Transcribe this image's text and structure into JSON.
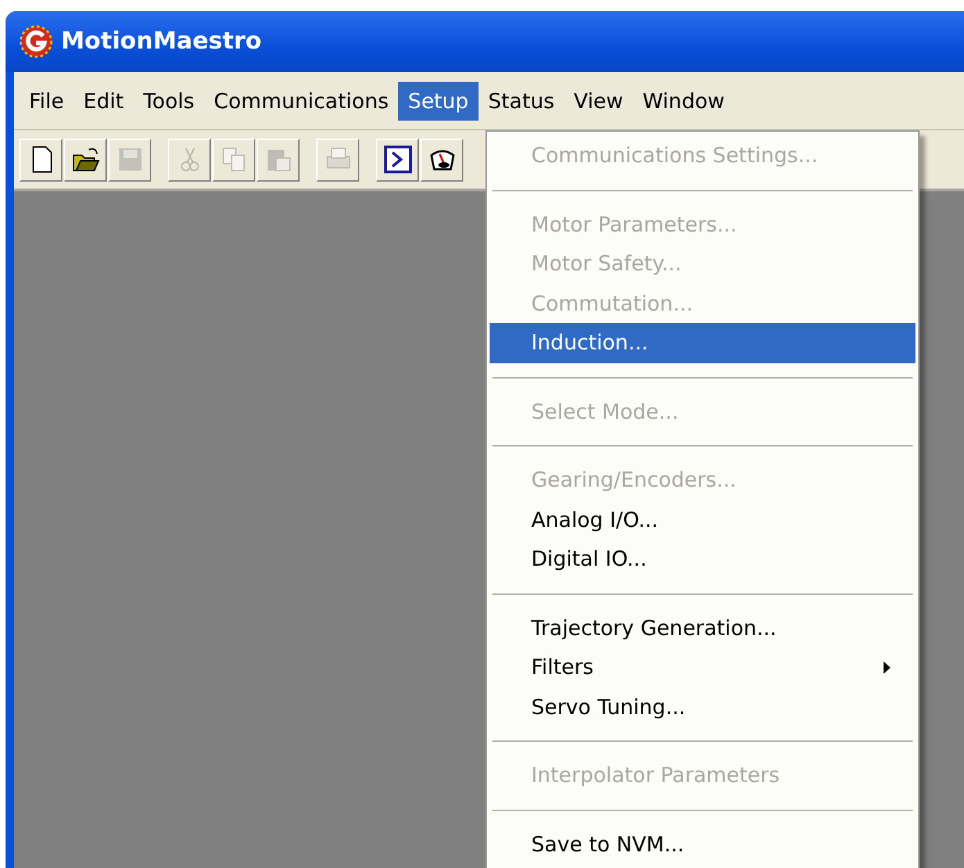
{
  "window": {
    "title": "MotionMaestro"
  },
  "menu_bar": [
    {
      "label": "File",
      "selected": false
    },
    {
      "label": "Edit",
      "selected": false
    },
    {
      "label": "Tools",
      "selected": false
    },
    {
      "label": "Communications",
      "selected": false
    },
    {
      "label": "Setup",
      "selected": true
    },
    {
      "label": "Status",
      "selected": false
    },
    {
      "label": "View",
      "selected": false
    },
    {
      "label": "Window",
      "selected": false
    }
  ],
  "toolbar": [
    {
      "kind": "new",
      "disabled": false
    },
    {
      "kind": "open",
      "disabled": false
    },
    {
      "kind": "save",
      "disabled": true
    },
    {
      "kind": "gap"
    },
    {
      "kind": "cut",
      "disabled": true
    },
    {
      "kind": "copy",
      "disabled": true
    },
    {
      "kind": "paste",
      "disabled": true
    },
    {
      "kind": "gap"
    },
    {
      "kind": "print",
      "disabled": true
    },
    {
      "kind": "gap"
    },
    {
      "kind": "terminal",
      "disabled": false
    },
    {
      "kind": "gauge",
      "disabled": false
    }
  ],
  "dropdown": [
    {
      "kind": "item",
      "label": "Communications Settings...",
      "disabled": true,
      "selected": false
    },
    {
      "kind": "separator"
    },
    {
      "kind": "item",
      "label": "Motor Parameters...",
      "disabled": true,
      "selected": false
    },
    {
      "kind": "item",
      "label": "Motor Safety...",
      "disabled": true,
      "selected": false
    },
    {
      "kind": "item",
      "label": "Commutation...",
      "disabled": true,
      "selected": false
    },
    {
      "kind": "item",
      "label": "Induction...",
      "disabled": false,
      "selected": true
    },
    {
      "kind": "separator"
    },
    {
      "kind": "item",
      "label": "Select Mode...",
      "disabled": true,
      "selected": false
    },
    {
      "kind": "separator"
    },
    {
      "kind": "item",
      "label": "Gearing/Encoders...",
      "disabled": true,
      "selected": false
    },
    {
      "kind": "item",
      "label": "Analog I/O...",
      "disabled": false,
      "selected": false
    },
    {
      "kind": "item",
      "label": "Digital IO...",
      "disabled": false,
      "selected": false
    },
    {
      "kind": "separator"
    },
    {
      "kind": "item",
      "label": "Trajectory Generation...",
      "disabled": false,
      "selected": false
    },
    {
      "kind": "item",
      "label": "Filters",
      "disabled": false,
      "selected": false,
      "submenu": true
    },
    {
      "kind": "item",
      "label": "Servo Tuning...",
      "disabled": false,
      "selected": false
    },
    {
      "kind": "separator"
    },
    {
      "kind": "item",
      "label": "Interpolator Parameters",
      "disabled": true,
      "selected": false
    },
    {
      "kind": "separator"
    },
    {
      "kind": "item",
      "label": "Save to NVM...",
      "disabled": false,
      "selected": false
    }
  ]
}
